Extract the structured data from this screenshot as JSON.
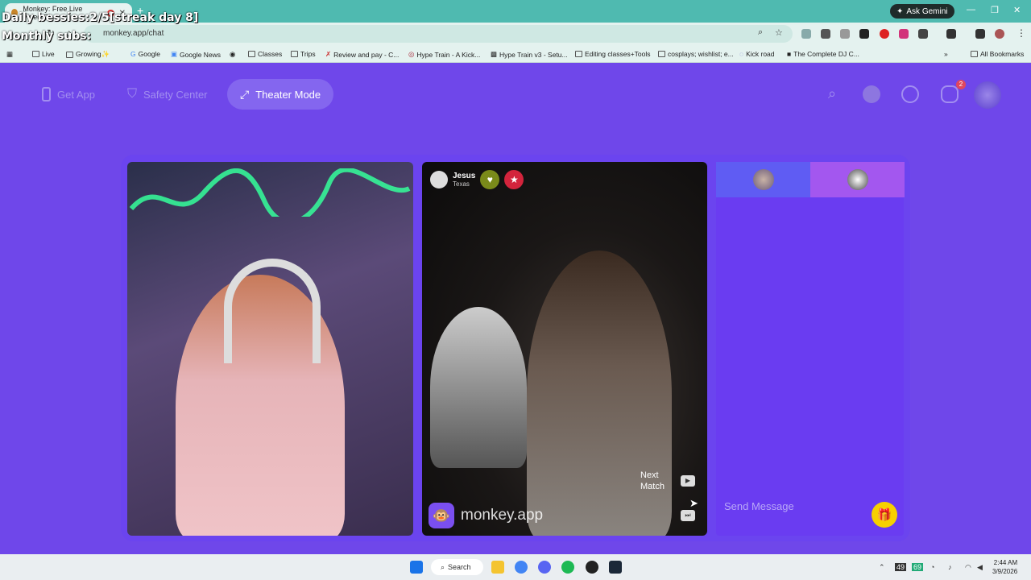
{
  "browser": {
    "tab_title": "Monkey: Free Live Video Cl...",
    "new_tab": "+",
    "ask_gemini": "Ask Gemini",
    "url": "monkey.app/chat",
    "overlay_line1": "Daily bessies:2/5[streak day 8]",
    "overlay_line2": "Monthly subs:",
    "bookmarks": [
      {
        "label": "Live"
      },
      {
        "label": "Growing✨"
      },
      {
        "label": "Google"
      },
      {
        "label": "Google News"
      },
      {
        "label": "Classes"
      },
      {
        "label": "Trips"
      },
      {
        "label": "Review and pay - C..."
      },
      {
        "label": "Hype Train - A Kick..."
      },
      {
        "label": "Hype Train v3 - Setu..."
      },
      {
        "label": "Editing classes+Tools"
      },
      {
        "label": "cosplays; wishlist; e..."
      },
      {
        "label": "Kick road"
      },
      {
        "label": "The Complete DJ C..."
      }
    ],
    "all_bookmarks": "All Bookmarks"
  },
  "header": {
    "get_app": "Get App",
    "safety_center": "Safety Center",
    "theater_mode": "Theater Mode",
    "notification_count": "2"
  },
  "match": {
    "name": "Jesus",
    "location": "Texas",
    "brand": "monkey.app",
    "next_match": "Next Match"
  },
  "chat": {
    "placeholder": "Send Message"
  },
  "taskbar": {
    "search": "Search",
    "time": "2:44 AM",
    "date": "3/9/2026",
    "tray_badge1": "49",
    "tray_badge2": "69"
  },
  "colors": {
    "page_bg": "#6f47ea",
    "accent_yellow": "#f7d000",
    "chrome_teal": "#4fbab0"
  }
}
